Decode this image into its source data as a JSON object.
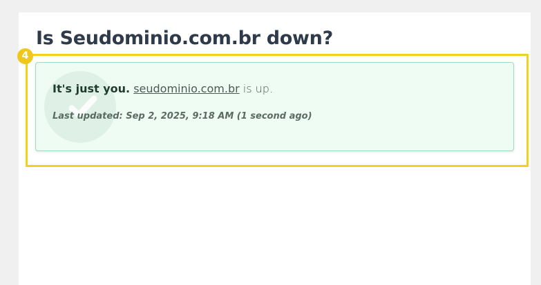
{
  "page": {
    "title": "Is Seudominio.com.br down?"
  },
  "annotation": {
    "badge_number": "4",
    "frame_color": "#f0d21c"
  },
  "status": {
    "lead": "It's just you.",
    "site_link": "seudominio.com.br",
    "suffix": "is up.",
    "last_updated": "Last updated: Sep 2, 2025, 9:18 AM (1 second ago)",
    "state": "up",
    "icon": "check-icon",
    "accent_color": "#9fdcc0"
  }
}
